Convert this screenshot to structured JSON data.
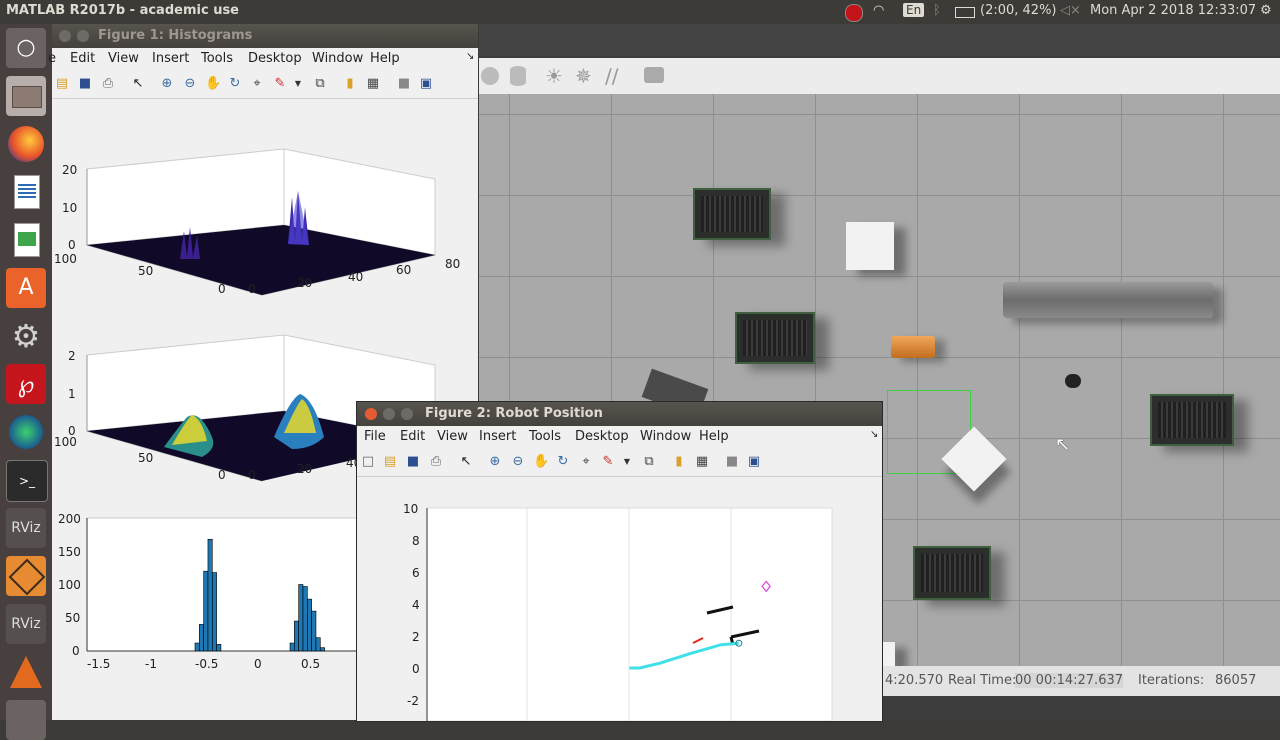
{
  "topbar": {
    "title": "MATLAB R2017b - academic use",
    "keyboard": "En",
    "battery": "(2:00, 42%)",
    "datetime": "Mon Apr  2 2018 12:33:07"
  },
  "launcher": {
    "items": [
      "ubuntu-icon",
      "files-icon",
      "firefox-icon",
      "writer-icon",
      "calc-icon",
      "software-center-icon",
      "settings-icon",
      "acrobat-icon",
      "world-icon",
      "terminal-icon",
      "rviz-icon",
      "gazebo-icon",
      "rviz-icon",
      "matlab-icon",
      "trash-icon"
    ],
    "rviz_label": "RViz"
  },
  "figure1": {
    "title": "Figure 1: Histograms",
    "menu": [
      "e",
      "Edit",
      "View",
      "Insert",
      "Tools",
      "Desktop",
      "Window",
      "Help"
    ],
    "plot1": {
      "zticks": [
        "20",
        "10",
        "0"
      ],
      "xticks": [
        "100",
        "50",
        "0"
      ],
      "yticks": [
        "0",
        "20",
        "40",
        "60",
        "80"
      ]
    },
    "plot2": {
      "zticks": [
        "2",
        "1",
        "0"
      ],
      "xticks": [
        "100",
        "50",
        "0"
      ],
      "yticks": [
        "0",
        "20",
        "40"
      ]
    },
    "plot3": {
      "yticks": [
        "200",
        "150",
        "100",
        "50",
        "0"
      ],
      "xticks": [
        "-1.5",
        "-1",
        "-0.5",
        "0",
        "0.5"
      ]
    }
  },
  "figure2": {
    "title": "Figure 2: Robot Position",
    "menu": [
      "File",
      "Edit",
      "View",
      "Insert",
      "Tools",
      "Desktop",
      "Window",
      "Help"
    ],
    "yticks": [
      "10",
      "8",
      "6",
      "4",
      "2",
      "0",
      "-2"
    ]
  },
  "simulator": {
    "sim_time": "4:20.570",
    "real_time_label": "Real Time:",
    "real_time": "00 00:14:27.637",
    "iterations_label": "Iterations:",
    "iterations": "86057"
  },
  "chart_data": [
    {
      "type": "bar",
      "title": "",
      "xlabel": "",
      "ylabel": "",
      "ylim": [
        0,
        200
      ],
      "xlim": [
        -1.6,
        0.9
      ],
      "categories": [
        "-0.58",
        "-0.54",
        "-0.50",
        "-0.46",
        "-0.42",
        "-0.38",
        "0.30",
        "0.34",
        "0.38",
        "0.42",
        "0.46",
        "0.50",
        "0.54",
        "0.58"
      ],
      "values": [
        12,
        40,
        120,
        168,
        118,
        10,
        12,
        45,
        100,
        97,
        78,
        60,
        20,
        5
      ]
    },
    {
      "type": "line",
      "title": "",
      "xlabel": "",
      "ylabel": "",
      "ylim": [
        -2,
        10
      ],
      "xlim": [
        -2,
        2
      ],
      "series": [
        {
          "values": [
            [
              0.0,
              0.0
            ],
            [
              0.1,
              0.0
            ],
            [
              0.3,
              0.3
            ],
            [
              0.6,
              0.9
            ],
            [
              0.9,
              1.45
            ],
            [
              1.08,
              1.55
            ]
          ]
        }
      ],
      "markers": [
        [
          1.35,
          5.1
        ]
      ]
    }
  ]
}
